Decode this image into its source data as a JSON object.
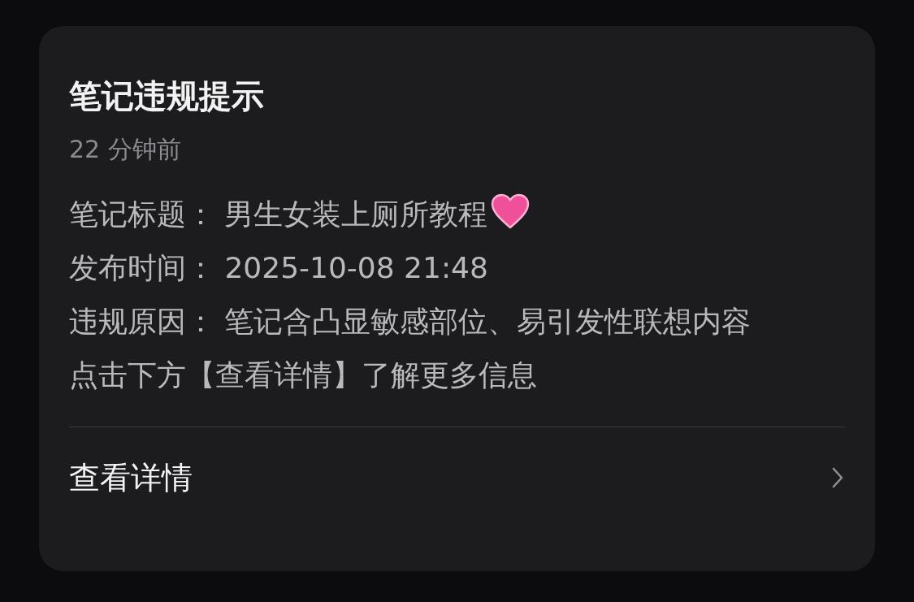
{
  "notice": {
    "title": "笔记违规提示",
    "time": "22 分钟前",
    "lines": [
      {
        "label": "笔记标题：",
        "value": "男生女装上厕所教程",
        "kind": "heart"
      },
      {
        "label": "发布时间：",
        "value": "2025-10-08 21:48",
        "kind": "plain"
      },
      {
        "label": "违规原因：",
        "value": "笔记含凸显敏感部位、易引发性联想内容",
        "kind": "plain"
      }
    ],
    "hint": "点击下方【查看详情】了解更多信息",
    "action": "查看详情"
  }
}
